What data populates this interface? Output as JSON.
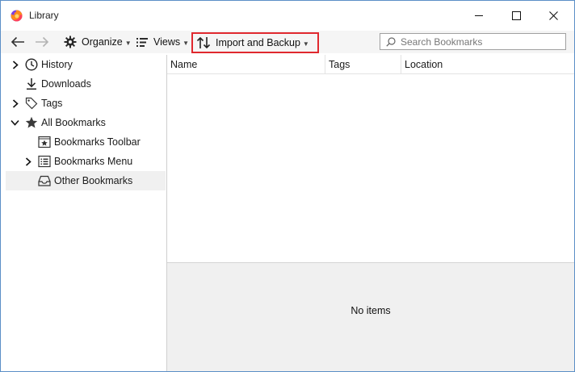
{
  "window": {
    "title": "Library"
  },
  "toolbar": {
    "organize": "Organize",
    "views": "Views",
    "import_backup": "Import and Backup",
    "search_placeholder": "Search Bookmarks"
  },
  "sidebar": {
    "items": [
      {
        "label": "History",
        "icon": "clock-icon",
        "expanded": false
      },
      {
        "label": "Downloads",
        "icon": "download-icon"
      },
      {
        "label": "Tags",
        "icon": "tag-icon",
        "expanded": false
      },
      {
        "label": "All Bookmarks",
        "icon": "star-icon",
        "expanded": true
      },
      {
        "label": "Bookmarks Toolbar",
        "icon": "bookmarks-toolbar-icon"
      },
      {
        "label": "Bookmarks Menu",
        "icon": "bookmarks-menu-icon",
        "expanded": false
      },
      {
        "label": "Other Bookmarks",
        "icon": "folder-tray-icon",
        "selected": true
      }
    ]
  },
  "columns": [
    "Name",
    "Tags",
    "Location"
  ],
  "details": {
    "empty_text": "No items"
  },
  "colors": {
    "highlight_border": "#e0282e",
    "selected_row": "#f0f0f0",
    "window_border": "#5b8fc7"
  }
}
